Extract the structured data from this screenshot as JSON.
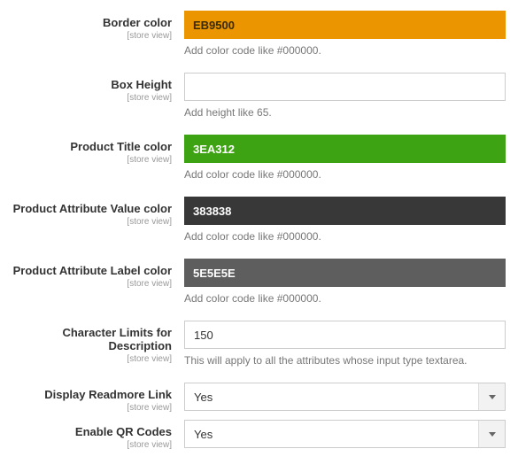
{
  "scopeLabel": "[store view]",
  "fields": {
    "borderColor": {
      "label": "Border color",
      "value": "EB9500",
      "bg": "#EB9500",
      "fg": "#3a2a00",
      "hint": "Add color code like #000000."
    },
    "boxHeight": {
      "label": "Box Height",
      "value": "",
      "hint": "Add height like 65."
    },
    "productTitleColor": {
      "label": "Product Title color",
      "value": "3EA312",
      "bg": "#3EA312",
      "fg": "#ffffff",
      "hint": "Add color code like #000000."
    },
    "attrValueColor": {
      "label": "Product Attribute Value color",
      "value": "383838",
      "bg": "#383838",
      "fg": "#ffffff",
      "hint": "Add color code like #000000."
    },
    "attrLabelColor": {
      "label": "Product Attribute Label color",
      "value": "5E5E5E",
      "bg": "#5E5E5E",
      "fg": "#ffffff",
      "hint": "Add color code like #000000."
    },
    "charLimit": {
      "label": "Character Limits for Description",
      "value": "150",
      "hint": "This will apply to all the attributes whose input type textarea."
    },
    "readmore": {
      "label": "Display Readmore Link",
      "value": "Yes"
    },
    "qrcodes": {
      "label": "Enable QR Codes",
      "value": "Yes"
    }
  }
}
